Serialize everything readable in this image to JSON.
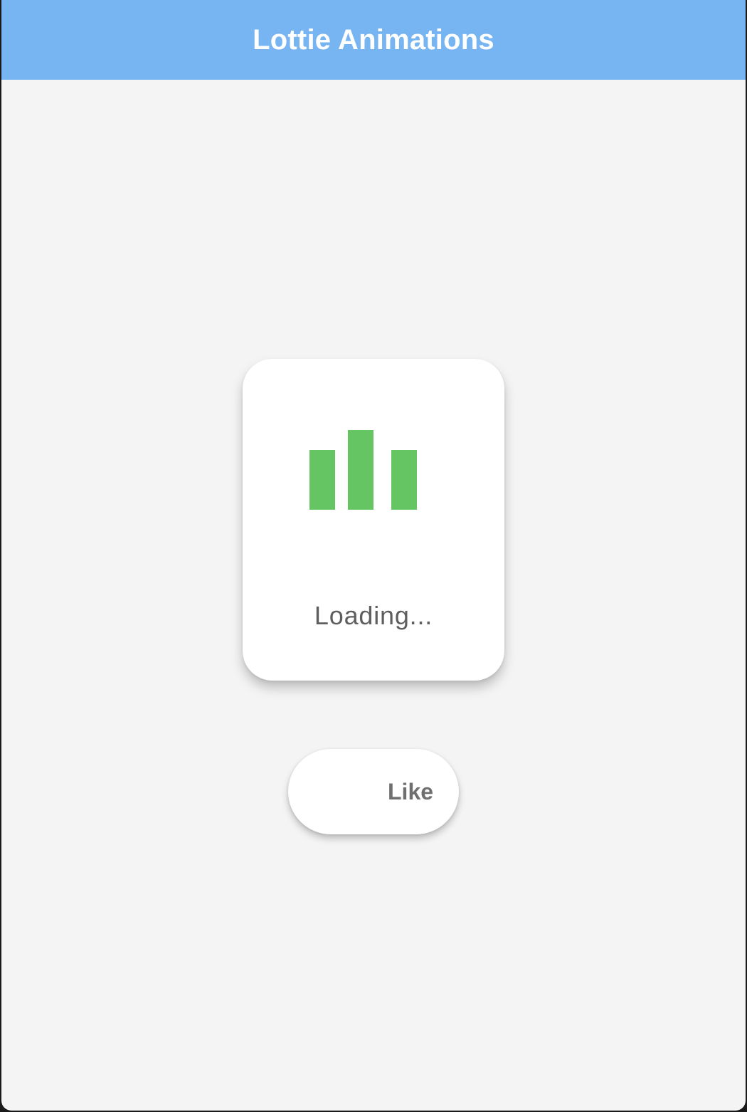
{
  "appbar": {
    "title": "Lottie Animations",
    "color": "#76b4f2"
  },
  "loader": {
    "label": "Loading...",
    "bar_color": "#66c563",
    "bars": [
      {
        "level": 0.75
      },
      {
        "level": 1.0
      },
      {
        "level": 0.75
      }
    ]
  },
  "like_button": {
    "label": "Like",
    "icon": "heart-icon"
  }
}
